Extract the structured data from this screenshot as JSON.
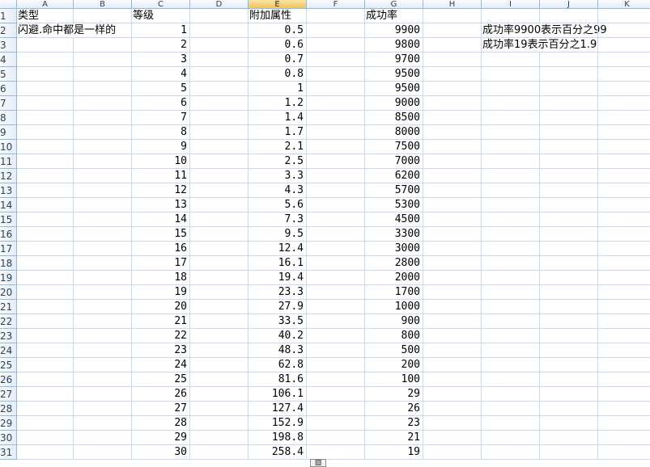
{
  "columns": [
    "A",
    "B",
    "C",
    "D",
    "E",
    "F",
    "G",
    "H",
    "I",
    "J",
    "K"
  ],
  "selected_column": "E",
  "row_numbers": [
    "1",
    "2",
    "3",
    "4",
    "5",
    "6",
    "7",
    "8",
    "9",
    "10",
    "11",
    "12",
    "13",
    "14",
    "15",
    "16",
    "17",
    "18",
    "19",
    "20",
    "21",
    "22",
    "23",
    "24",
    "25",
    "26",
    "27",
    "28",
    "29",
    "30",
    "31"
  ],
  "header": {
    "type": "类型",
    "level": "等级",
    "bonus": "附加属性",
    "rate": "成功率"
  },
  "type_value": "闪避.命中都是一样的",
  "notes": [
    "成功率9900表示百分之99",
    "成功率19表示百分之1.9"
  ],
  "rows": [
    {
      "level": "1",
      "bonus": "0.5",
      "rate": "9900"
    },
    {
      "level": "2",
      "bonus": "0.6",
      "rate": "9800"
    },
    {
      "level": "3",
      "bonus": "0.7",
      "rate": "9700"
    },
    {
      "level": "4",
      "bonus": "0.8",
      "rate": "9500"
    },
    {
      "level": "5",
      "bonus": "1",
      "rate": "9500"
    },
    {
      "level": "6",
      "bonus": "1.2",
      "rate": "9000"
    },
    {
      "level": "7",
      "bonus": "1.4",
      "rate": "8500"
    },
    {
      "level": "8",
      "bonus": "1.7",
      "rate": "8000"
    },
    {
      "level": "9",
      "bonus": "2.1",
      "rate": "7500"
    },
    {
      "level": "10",
      "bonus": "2.5",
      "rate": "7000"
    },
    {
      "level": "11",
      "bonus": "3.3",
      "rate": "6200"
    },
    {
      "level": "12",
      "bonus": "4.3",
      "rate": "5700"
    },
    {
      "level": "13",
      "bonus": "5.6",
      "rate": "5300"
    },
    {
      "level": "14",
      "bonus": "7.3",
      "rate": "4500"
    },
    {
      "level": "15",
      "bonus": "9.5",
      "rate": "3300"
    },
    {
      "level": "16",
      "bonus": "12.4",
      "rate": "3000"
    },
    {
      "level": "17",
      "bonus": "16.1",
      "rate": "2800"
    },
    {
      "level": "18",
      "bonus": "19.4",
      "rate": "2000"
    },
    {
      "level": "19",
      "bonus": "23.3",
      "rate": "1700"
    },
    {
      "level": "20",
      "bonus": "27.9",
      "rate": "1000"
    },
    {
      "level": "21",
      "bonus": "33.5",
      "rate": "900"
    },
    {
      "level": "22",
      "bonus": "40.2",
      "rate": "800"
    },
    {
      "level": "23",
      "bonus": "48.3",
      "rate": "500"
    },
    {
      "level": "24",
      "bonus": "62.8",
      "rate": "200"
    },
    {
      "level": "25",
      "bonus": "81.6",
      "rate": "100"
    },
    {
      "level": "26",
      "bonus": "106.1",
      "rate": "29"
    },
    {
      "level": "27",
      "bonus": "127.4",
      "rate": "26"
    },
    {
      "level": "28",
      "bonus": "152.9",
      "rate": "23"
    },
    {
      "level": "29",
      "bonus": "198.8",
      "rate": "21"
    },
    {
      "level": "30",
      "bonus": "258.4",
      "rate": "19"
    }
  ],
  "paste_options_icon": "paste-options-icon"
}
